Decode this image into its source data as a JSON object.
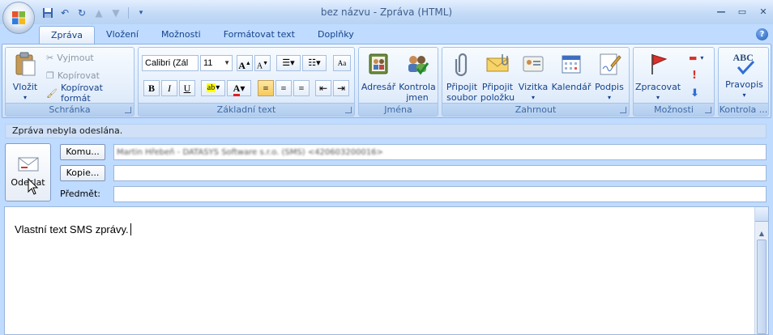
{
  "window": {
    "title": "bez názvu - Zpráva (HTML)"
  },
  "tabs": [
    "Zpráva",
    "Vložení",
    "Možnosti",
    "Formátovat text",
    "Doplňky"
  ],
  "ribbon": {
    "clipboard": {
      "label": "Schránka",
      "paste": "Vložit",
      "cut": "Vyjmout",
      "copy": "Kopírovat",
      "format_painter": "Kopírovat formát"
    },
    "basic_text": {
      "label": "Základní text",
      "font_name": "Calibri (Zál",
      "font_size": "11",
      "bold": "B",
      "italic": "I",
      "underline": "U"
    },
    "names": {
      "label": "Jména",
      "address_book": "Adresář",
      "check_names_1": "Kontrola",
      "check_names_2": "jmen"
    },
    "include": {
      "label": "Zahrnout",
      "attach_file_1": "Připojit",
      "attach_file_2": "soubor",
      "attach_item_1": "Připojit",
      "attach_item_2": "položku",
      "business_card": "Vizitka",
      "calendar": "Kalendář",
      "signature": "Podpis"
    },
    "options": {
      "label": "Možnosti",
      "follow_up": "Zpracovat"
    },
    "proofing": {
      "label": "Kontrola ...",
      "spelling": "Pravopis",
      "spelling_icon_text": "ABC"
    }
  },
  "infobar": {
    "text": "Zpráva nebyla odeslána."
  },
  "compose": {
    "send": "Odeslat",
    "to_button": "Komu...",
    "to_value": "Martin Hřebeň - DATASYS Software s.r.o. (SMS) <420603200016>",
    "cc_button": "Kopie...",
    "cc_value": "",
    "subject_label": "Předmět:",
    "subject_value": "",
    "body": "Vlastní text SMS zprávy."
  }
}
